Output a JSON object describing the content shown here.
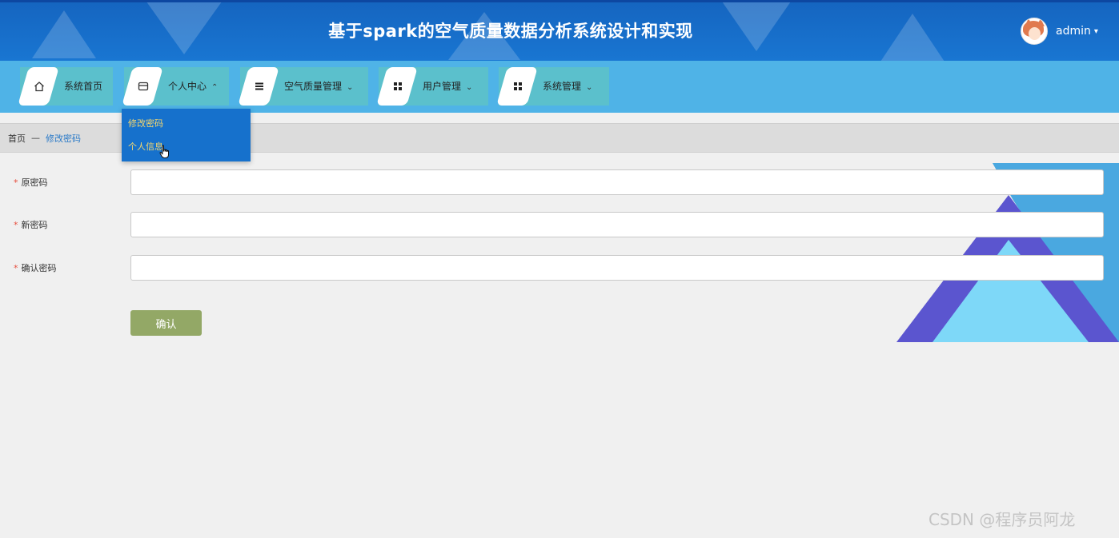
{
  "header": {
    "title": "基于spark的空气质量数据分析系统设计和实现",
    "user": {
      "name": "admin",
      "caret": "▾"
    }
  },
  "nav": {
    "items": [
      {
        "label": "系统首页",
        "icon": "home-icon",
        "caret": ""
      },
      {
        "label": "个人中心",
        "icon": "card-icon",
        "caret": "⌃"
      },
      {
        "label": "空气质量管理",
        "icon": "list-icon",
        "caret": "⌄"
      },
      {
        "label": "用户管理",
        "icon": "grid-icon",
        "caret": "⌄"
      },
      {
        "label": "系统管理",
        "icon": "grid-icon",
        "caret": "⌄"
      }
    ],
    "dropdown": [
      {
        "label": "修改密码"
      },
      {
        "label": "个人信息"
      }
    ]
  },
  "breadcrumb": {
    "home": "首页",
    "separator": "—",
    "current": "修改密码"
  },
  "form": {
    "fields": [
      {
        "label": "原密码",
        "required": "*",
        "value": ""
      },
      {
        "label": "新密码",
        "required": "*",
        "value": ""
      },
      {
        "label": "确认密码",
        "required": "*",
        "value": ""
      }
    ],
    "submit_label": "确认"
  },
  "watermark": "CSDN @程序员阿龙",
  "colors": {
    "header_bg": "#1976d2",
    "nav_bg": "#4fb3e7",
    "nav_item_bg": "#5bc0cc",
    "dropdown_bg": "#1671cc",
    "dropdown_text": "#f5d76e",
    "button_bg": "#93a866",
    "breadcrumb_link": "#2a7ac8"
  }
}
